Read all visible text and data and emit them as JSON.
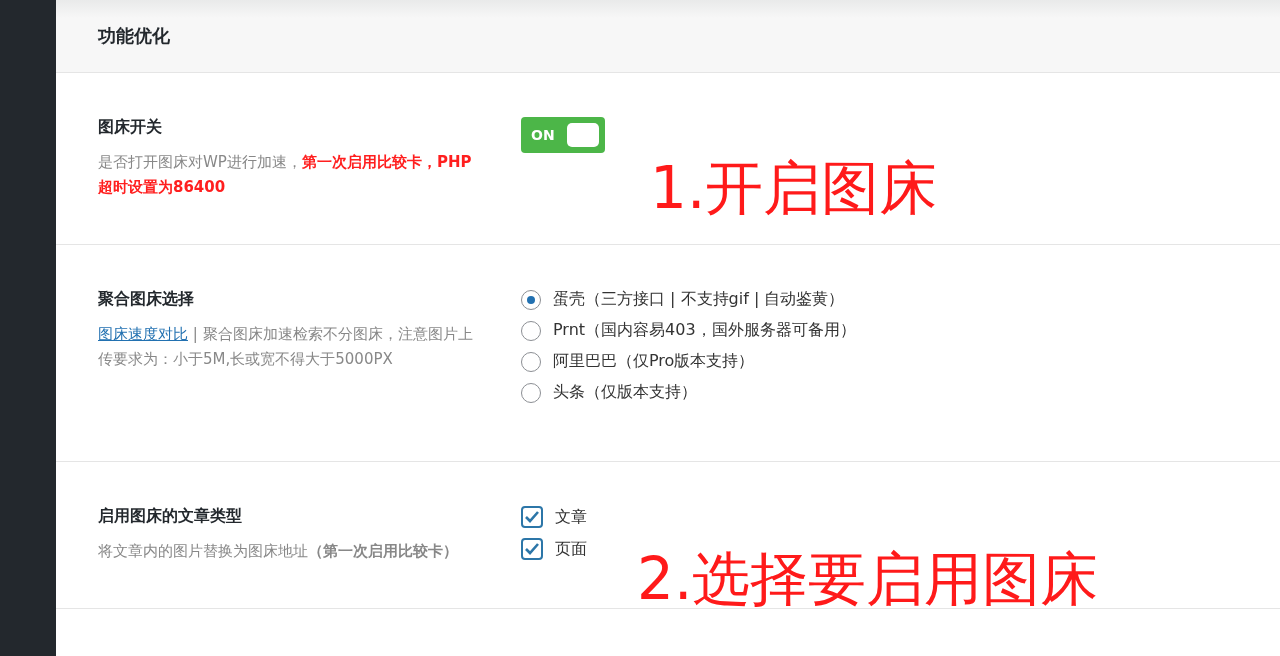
{
  "section": {
    "title": "功能优化"
  },
  "settings": [
    {
      "kind": "toggle",
      "label": "图床开关",
      "description": "是否打开图床对WP进行加速，**第一次启用比较卡，PHP超时设置为86400**",
      "toggle": {
        "label": "ON",
        "on": true
      },
      "annotation": "1.开启图床"
    },
    {
      "kind": "radio",
      "label": "聚合图床选择",
      "description_link": "图床速度对比",
      "description": " | 聚合图床加速检索不分图床，注意图片上传要求为：小于5M,长或宽不得大于5000PX",
      "options": [
        {
          "label": "蛋壳（三方接口 | 不支持gif | 自动鉴黄）",
          "selected": true
        },
        {
          "label": "Prnt（国内容易403，国外服务器可备用）",
          "selected": false
        },
        {
          "label": "阿里巴巴（仅Pro版本支持）",
          "selected": false
        },
        {
          "label": "头条（仅版本支持）",
          "selected": false
        }
      ]
    },
    {
      "kind": "checkbox",
      "label": "启用图床的文章类型",
      "description": "将文章内的图片替换为图床地址**（第一次启用比较卡）**",
      "options": [
        {
          "label": "文章",
          "checked": true
        },
        {
          "label": "页面",
          "checked": true
        }
      ],
      "annotation": "2.选择要启用图床"
    }
  ]
}
